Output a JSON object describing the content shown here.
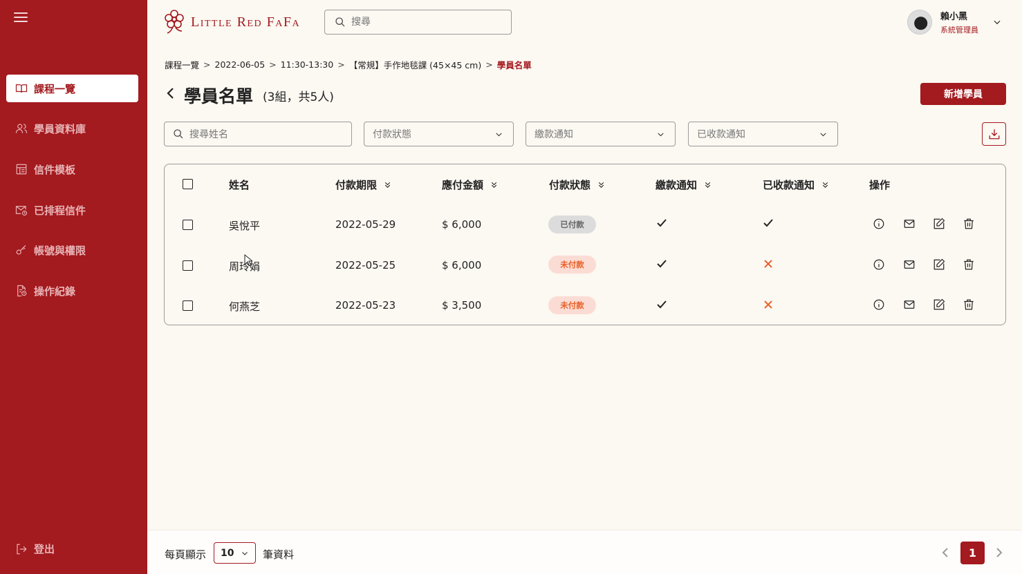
{
  "brand": {
    "name": "Little Red FaFa",
    "primary": "#A31A1F",
    "accent_orange": "#E8622B",
    "background": "#FCF8F2"
  },
  "sidebar": {
    "items": [
      {
        "label": "課程一覽",
        "icon": "book-open-icon",
        "active": true
      },
      {
        "label": "學員資料庫",
        "icon": "users-icon",
        "active": false
      },
      {
        "label": "信件模板",
        "icon": "template-icon",
        "active": false
      },
      {
        "label": "已排程信件",
        "icon": "scheduled-mail-icon",
        "active": false
      },
      {
        "label": "帳號與權限",
        "icon": "key-icon",
        "active": false
      },
      {
        "label": "操作紀錄",
        "icon": "log-icon",
        "active": false
      }
    ],
    "logout_label": "登出"
  },
  "header": {
    "search_placeholder": "搜尋",
    "user": {
      "name": "賴小黑",
      "role": "系統管理員"
    }
  },
  "breadcrumb": [
    "課程一覽",
    "2022-06-05",
    "11:30-13:30",
    "【常規】手作地毯課 (45×45 cm)",
    "學員名單"
  ],
  "page": {
    "title": "學員名單",
    "subtitle": "(3組，共5人)",
    "add_button": "新增學員"
  },
  "filters": {
    "name_placeholder": "搜尋姓名",
    "payment_status": "付款狀態",
    "payment_notice": "繳款通知",
    "received_notice": "已收款通知"
  },
  "table": {
    "columns": [
      "姓名",
      "付款期限",
      "應付金額",
      "付款狀態",
      "繳款通知",
      "已收款通知",
      "操作"
    ],
    "rows": [
      {
        "name": "吳悅平",
        "due": "2022-05-29",
        "amount": "$ 6,000",
        "status": "已付款",
        "status_type": "paid",
        "payment_notice": true,
        "received_notice": true
      },
      {
        "name": "周玲娟",
        "due": "2022-05-25",
        "amount": "$ 6,000",
        "status": "未付款",
        "status_type": "unpaid",
        "payment_notice": true,
        "received_notice": false
      },
      {
        "name": "何燕芝",
        "due": "2022-05-23",
        "amount": "$ 3,500",
        "status": "未付款",
        "status_type": "unpaid",
        "payment_notice": true,
        "received_notice": false
      }
    ],
    "actions": [
      "info-icon",
      "mail-icon",
      "edit-icon",
      "trash-icon"
    ]
  },
  "footer": {
    "per_page_label": "每頁顯示",
    "per_page_value": "10",
    "records_label": "筆資料",
    "current_page": "1"
  }
}
